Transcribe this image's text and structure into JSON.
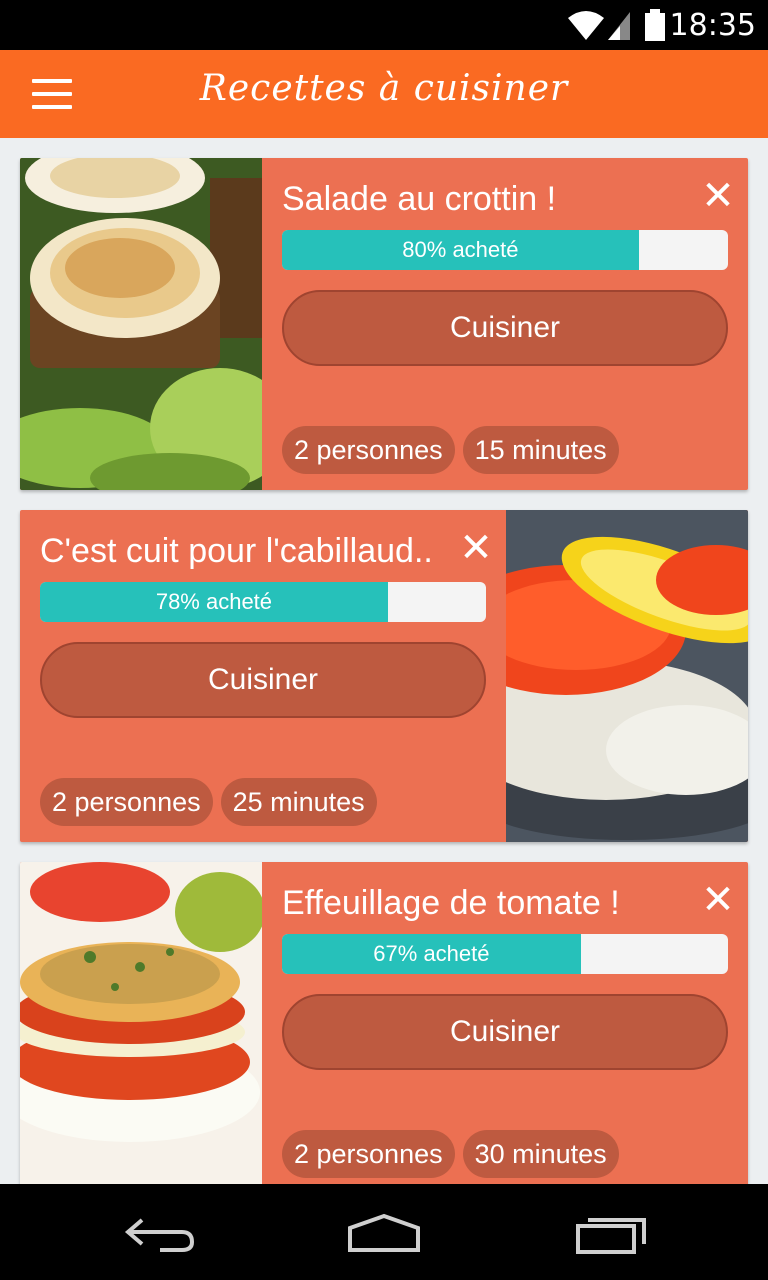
{
  "status_bar": {
    "time": "18:35"
  },
  "app_bar": {
    "title": "Recettes à cuisiner"
  },
  "recipes": [
    {
      "name": "Salade au crottin !",
      "progress": 80,
      "progress_label": "80% acheté",
      "cook_label": "Cuisiner",
      "people": "2 personnes",
      "duration": "15 minutes"
    },
    {
      "name": "C'est cuit pour l'cabillaud..",
      "progress": 78,
      "progress_label": "78% acheté",
      "cook_label": "Cuisiner",
      "people": "2 personnes",
      "duration": "25 minutes"
    },
    {
      "name": "Effeuillage de tomate !",
      "progress": 67,
      "progress_label": "67% acheté",
      "cook_label": "Cuisiner",
      "people": "2 personnes",
      "duration": "30 minutes"
    }
  ],
  "colors": {
    "app_bar": "#fa6a22",
    "card": "#ec7052",
    "button": "#be5a40",
    "progress_fill": "#26c1ba",
    "progress_track": "#f4f4f4"
  },
  "icons": {
    "menu": "hamburger-icon",
    "close": "close-icon",
    "back": "back-icon",
    "home": "home-icon",
    "recents": "recents-icon",
    "wifi": "wifi-icon",
    "cellular": "cellular-signal-icon",
    "battery": "battery-icon"
  }
}
